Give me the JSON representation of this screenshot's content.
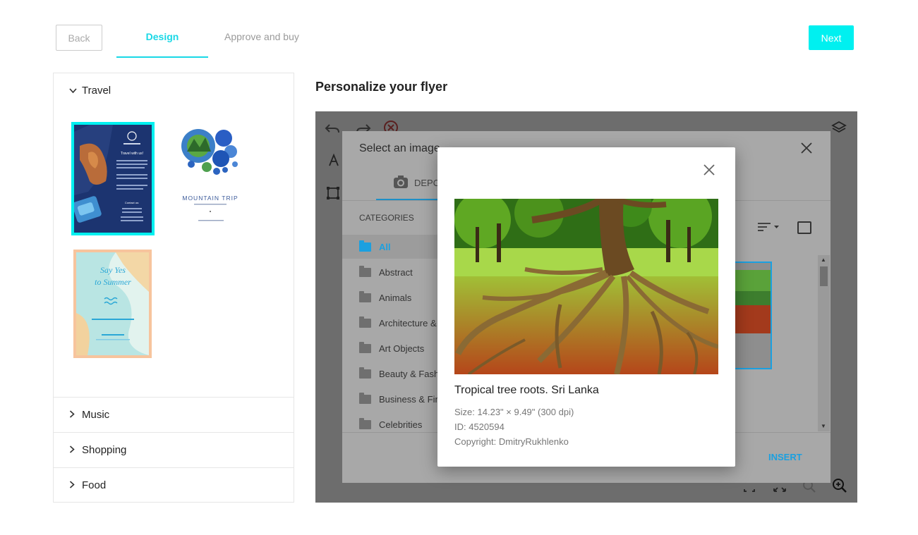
{
  "header": {
    "back_label": "Back",
    "tab_design": "Design",
    "tab_approve": "Approve and buy",
    "next_label": "Next"
  },
  "sidebar": {
    "categories": [
      {
        "label": "Travel",
        "expanded": true
      },
      {
        "label": "Music",
        "expanded": false
      },
      {
        "label": "Shopping",
        "expanded": false
      },
      {
        "label": "Food",
        "expanded": false
      }
    ],
    "templates": [
      {
        "name": "travel-with-us",
        "title": "Travel with us!",
        "selected": true
      },
      {
        "name": "mountain-trip",
        "title": "MOUNTAIN TRIP",
        "selected": false
      },
      {
        "name": "say-yes-to-summer",
        "title": "Say Yes to Summer",
        "selected": false
      }
    ]
  },
  "main": {
    "heading": "Personalize your flyer"
  },
  "image_dialog": {
    "title": "Select an image",
    "tab_label": "DEPO",
    "categories_label": "CATEGORIES",
    "categories": [
      "All",
      "Abstract",
      "Animals",
      "Architecture &",
      "Art Objects",
      "Beauty & Fash",
      "Business & Fin",
      "Celebrities"
    ],
    "active_category": "All",
    "insert_label": "INSERT"
  },
  "preview": {
    "title": "Tropical tree roots. Sri Lanka",
    "size": "Size: 14.23\" × 9.49\" (300 dpi)",
    "id": "ID: 4520594",
    "copyright": "Copyright: DmitryRukhlenko"
  },
  "colors": {
    "accent": "#00f0f0",
    "accent_text": "#19d8e6",
    "link_blue": "#1ba0e0"
  }
}
